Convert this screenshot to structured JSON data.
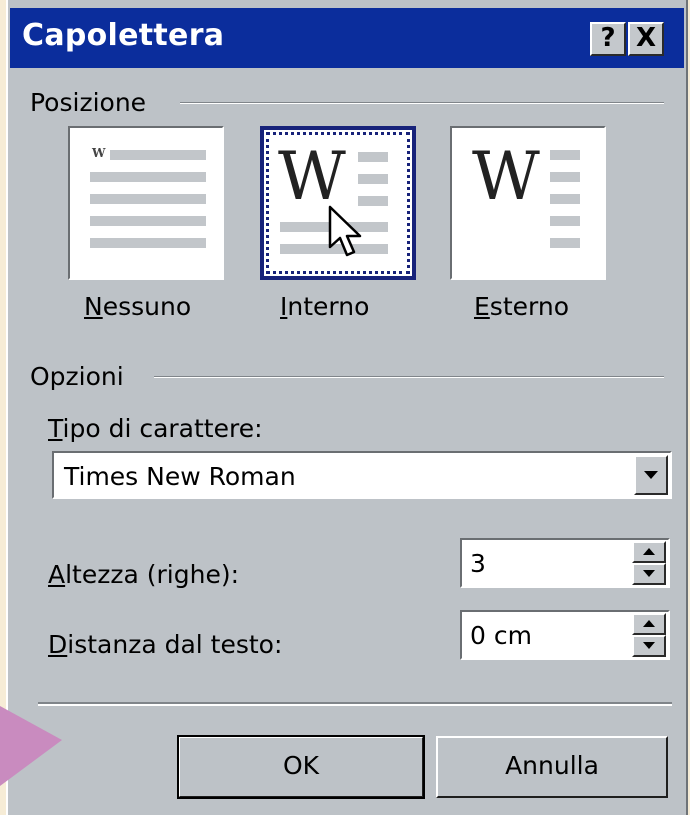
{
  "window": {
    "title": "Capolettera",
    "help_button": "?",
    "close_button": "X"
  },
  "position": {
    "group_label": "Posizione",
    "options": [
      {
        "label_ul": "N",
        "label_rest": "essuno",
        "selected": false
      },
      {
        "label_ul": "I",
        "label_rest": "nterno",
        "selected": true
      },
      {
        "label_ul": "E",
        "label_rest": "sterno",
        "selected": false
      }
    ],
    "thumb_letter_small": "W",
    "thumb_letter_big": "W"
  },
  "options": {
    "group_label": "Opzioni",
    "font_label_ul": "T",
    "font_label_rest": "ipo di carattere:",
    "font_value": "Times New Roman",
    "height_label_ul": "A",
    "height_label_rest": "ltezza (righe):",
    "height_value": "3",
    "distance_label_ul": "D",
    "distance_label_rest": "istanza dal testo:",
    "distance_value": "0 cm"
  },
  "buttons": {
    "ok": "OK",
    "cancel": "Annulla"
  },
  "colors": {
    "titlebar": "#0b2d9c",
    "dialog_face": "#bdc2c7",
    "page_bg": "#f6ecd6",
    "pointer": "#c98bbf"
  }
}
